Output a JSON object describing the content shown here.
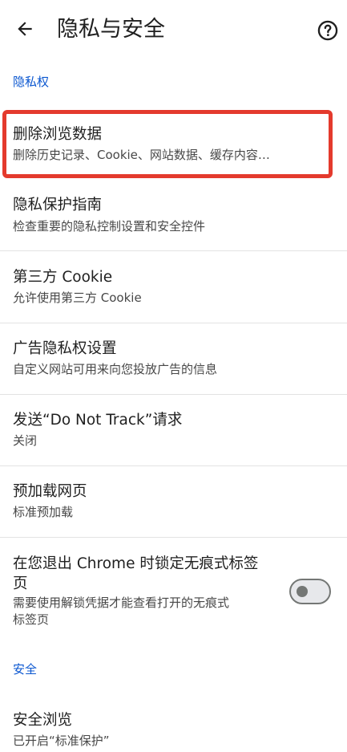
{
  "appbar": {
    "title": "隐私与安全",
    "back_icon": "arrow-left-icon",
    "help_icon": "help-circle-icon"
  },
  "sections": {
    "privacy_header": "隐私权",
    "security_header": "安全"
  },
  "items": [
    {
      "title": "删除浏览数据",
      "subtitle": "删除历史记录、Cookie、网站数据、缓存内容…"
    },
    {
      "title": "隐私保护指南",
      "subtitle": "检查重要的隐私控制设置和安全控件"
    },
    {
      "title": "第三方 Cookie",
      "subtitle": "允许使用第三方 Cookie"
    },
    {
      "title": "广告隐私权设置",
      "subtitle": "自定义网站可用来向您投放广告的信息"
    },
    {
      "title": "发送“Do Not Track”请求",
      "subtitle": "关闭"
    },
    {
      "title": "预加载网页",
      "subtitle": "标准预加载"
    },
    {
      "title_line1": "在您退出 Chrome 时锁定无痕式标签",
      "title_line2": "页",
      "subtitle_line1": "需要使用解锁凭据才能查看打开的无痕式",
      "subtitle_line2": "标签页",
      "toggle_on": false
    },
    {
      "title": "安全浏览",
      "subtitle": "已开启“标准保护”"
    }
  ],
  "colors": {
    "accent": "#0b57d0",
    "highlight": "#e43a2d",
    "text": "#1f1f1f",
    "subtext": "#474747",
    "divider": "#e3e3e3"
  }
}
